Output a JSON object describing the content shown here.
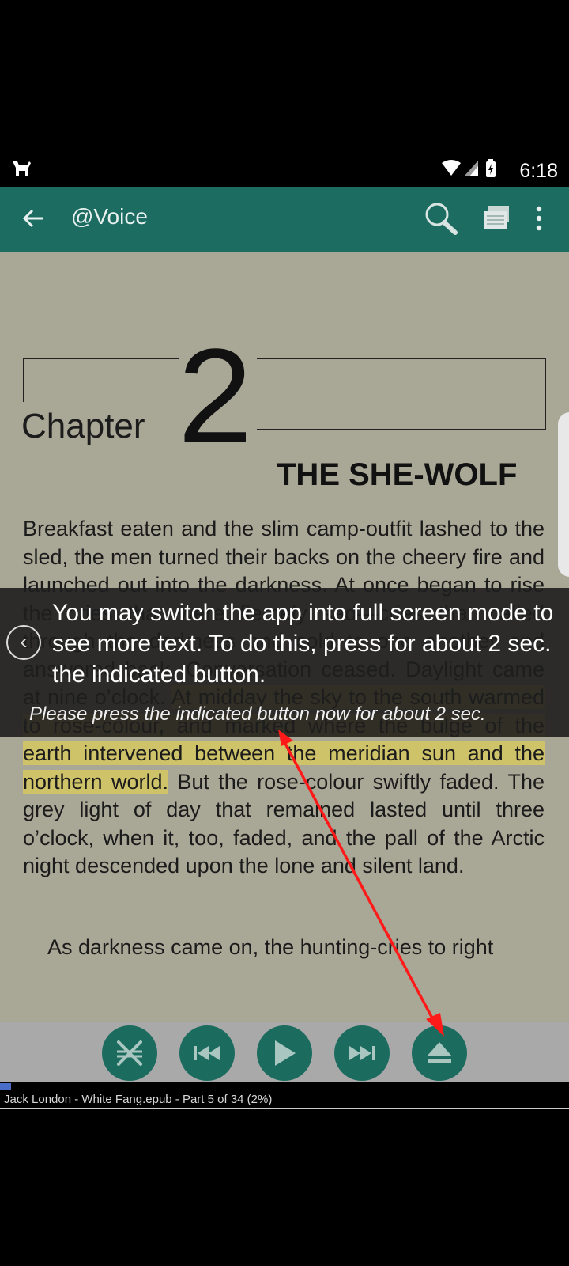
{
  "status_bar": {
    "time": "6:18"
  },
  "app_bar": {
    "title": "@Voice"
  },
  "chapter": {
    "word": "Chapter",
    "number": "2",
    "title": "THE SHE-WOLF"
  },
  "text": {
    "para1_plain": "Breakfast eaten and the slim camp-outfit lashed to the sled, the men turned their backs on the cheery fire and launched out into the darkness. At once began to rise the cries that were fiercely sad—cries that called through the darkness and cold to one another and answered back. Conversation ceased. Daylight came at nine o’clock.",
    "para1_highlight": "At midday the sky to the south warmed to rose-colour, and marked where the bulge of the earth intervened between the meridian sun and the northern world.",
    "para1_rest": "But the rose-colour swiftly faded. The grey light of day that remained lasted until three o’clock, when it, too, faded, and the pall of the Arctic night descended upon the lone and silent land.",
    "para2": "As darkness came on, the hunting-cries to right"
  },
  "tip": {
    "main": "You may switch the app into full screen mode to see more text. To do this, press for about 2 sec. the indicated button.",
    "sub": "Please press the indicated button now for about 2 sec."
  },
  "player": {
    "buttons": [
      "no-sleep-timer-icon",
      "previous-icon",
      "play-icon",
      "next-icon",
      "eject-icon"
    ]
  },
  "footer": {
    "file_info": "Jack London - White Fang.epub - Part 5 of 34  (2%)"
  },
  "colors": {
    "app_bar": "#1d6c62",
    "page_bg": "#a9a796",
    "highlight": "#cfc36a",
    "player_button": "#1b6c5f",
    "arrow": "#ff1a1a"
  }
}
